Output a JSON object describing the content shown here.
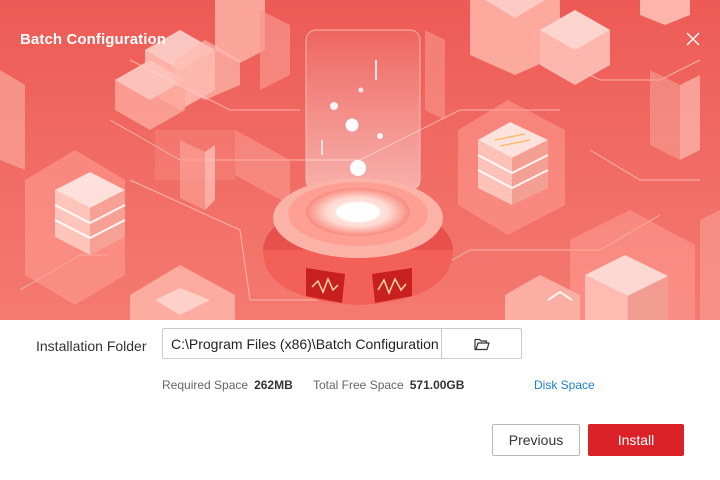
{
  "window": {
    "title": "Batch Configuration"
  },
  "install": {
    "folder_label": "Installation Folder",
    "folder_path": "C:\\Program Files (x86)\\Batch Configuration",
    "required_label": "Required Space",
    "required_value": "262MB",
    "free_label": "Total Free Space",
    "free_value": "571.00GB",
    "disk_space_link": "Disk Space"
  },
  "buttons": {
    "previous": "Previous",
    "install": "Install"
  },
  "colors": {
    "brand_red": "#da2128",
    "banner_red": "#ee5a55",
    "link_blue": "#1e7fd6"
  },
  "icons": {
    "close": "close-icon",
    "browse": "folder-open-icon"
  }
}
